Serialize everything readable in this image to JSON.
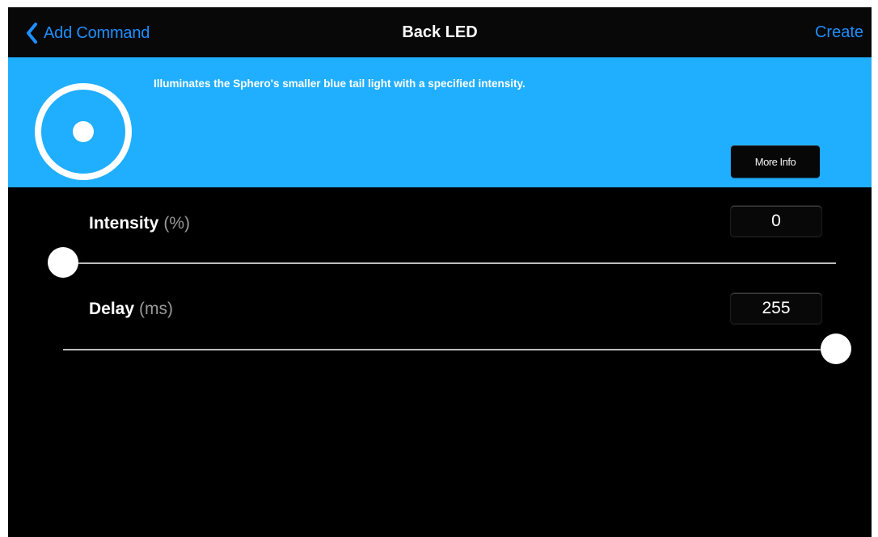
{
  "navbar": {
    "back_label": "Add Command",
    "title": "Back LED",
    "create_label": "Create"
  },
  "info": {
    "description": "Illuminates the Sphero's smaller blue tail light with a specified intensity.",
    "more_info_label": "More Info",
    "icon": "back-led-icon"
  },
  "params": [
    {
      "label": "Intensity",
      "unit": "(%)",
      "value": "0",
      "fraction": 0.0
    },
    {
      "label": "Delay",
      "unit": "(ms)",
      "value": "255",
      "fraction": 1.0
    }
  ],
  "colors": {
    "accent": "#1f8fff",
    "band": "#20aeff",
    "background": "#000000"
  }
}
